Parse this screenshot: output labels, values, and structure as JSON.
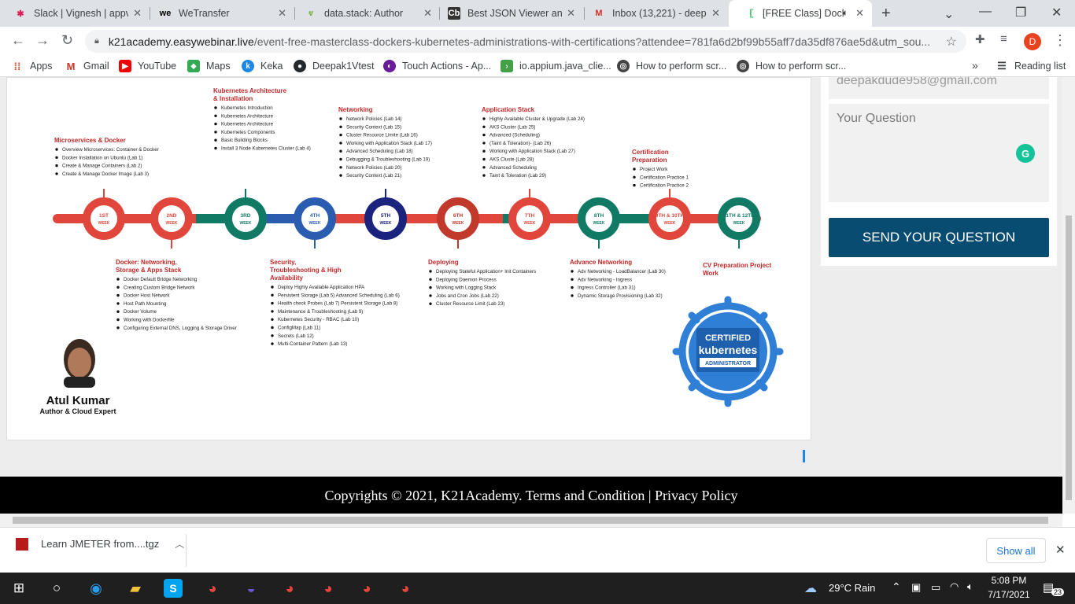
{
  "tabs": [
    {
      "title": "Slack | Vignesh | appve",
      "icon": "slack-icon",
      "color": "#e01e5a"
    },
    {
      "title": "WeTransfer",
      "icon": "wetransfer-icon",
      "color": "#000000"
    },
    {
      "title": "data.stack: Author",
      "icon": "datastack-icon",
      "color": "#7cb342"
    },
    {
      "title": "Best JSON Viewer and",
      "icon": "codebeautify-icon",
      "color": "#333333"
    },
    {
      "title": "Inbox (13,221) - deepa",
      "icon": "gmail-icon",
      "color": "#d93025"
    },
    {
      "title": "[FREE Class] Docke",
      "icon": "easywebinar-icon",
      "color": "#1db954"
    }
  ],
  "address": {
    "host": "k21academy.easywebinar.live",
    "path": "/event-free-masterclass-dockers-kubernetes-administrations-with-certifications?attendee=781fa6d2bf99b55aff7da35df876ae5d&utm_sou..."
  },
  "profile_initial": "D",
  "bookmarks": [
    {
      "label": "Apps"
    },
    {
      "label": "Gmail"
    },
    {
      "label": "YouTube"
    },
    {
      "label": "Maps"
    },
    {
      "label": "Keka"
    },
    {
      "label": "Deepak1Vtest"
    },
    {
      "label": "Touch Actions - Ap..."
    },
    {
      "label": "io.appium.java_clie..."
    },
    {
      "label": "How to perform scr..."
    },
    {
      "label": "How to perform scr..."
    },
    {
      "label": "Reading list"
    }
  ],
  "roadmap": {
    "weeks": [
      "1ST WEEK",
      "2ND WEEK",
      "3RD WEEK",
      "4TH WEEK",
      "5TH WEEK",
      "6TH WEEK",
      "7TH WEEK",
      "8TH WEEK",
      "9TH & 10TH WEEK",
      "11TH & 12TH WEEK"
    ],
    "top_sections": [
      {
        "title": "Microservices & Docker",
        "items": [
          "Overview Microservices: Container & Docker",
          "Docker Installation on Ubuntu (Lab 1)",
          "Create & Manage Containers (Lab 2)",
          "Create & Manage Docker Image (Lab 3)"
        ]
      },
      {
        "title": "Kubernetes Architecture & Installation",
        "items": [
          "Kubernetes Introduction",
          "Kubernetes Architecture",
          "Kubernetes Architecture",
          "Kubernetes Components",
          "Basic Building Blocks",
          "Install 3 Node Kubernetes Cluster (Lab 4)"
        ]
      },
      {
        "title": "Networking",
        "items": [
          "Network Policies (Lab 14)",
          "Security Context (Lab 15)",
          "Cluster Resource Limite (Lab 16)",
          "Working with Application Stack (Lab 17)",
          "Advanced Scheduling (Lab 18)",
          "Debugging & Troubleshooting (Lab 19)",
          "Network Policies (Lab 20)",
          "Security Context (Lab 21)"
        ]
      },
      {
        "title": "Application Stack",
        "items": [
          "Highly Available Cluster & Upgrade (Lab 24)",
          "AKS Cluster (Lab 25)",
          "Advanced (Scheduling)",
          "(Taint & Toleration)- (Lab 26)",
          "Working with Application Stack (Lab 27)",
          "AKS Cluste (Lab 28)",
          "Advanced Scheduling",
          "Taint & Toleration (Lab 29)"
        ]
      },
      {
        "title": "Certification Preparation",
        "items": [
          "Project Work",
          "Certification Practice 1",
          "Certification Practice 2"
        ]
      }
    ],
    "bottom_sections": [
      {
        "title": "Docker: Networking, Storage & Apps Stack",
        "items": [
          "Docker Default Bridge Networking",
          "Creating Custom Bridge Network",
          "Docker Host Network",
          "Host Path Mounting",
          "Docker Volume",
          "Working with Dockerfile",
          "Configuring External DNS, Logging & Storage Driver"
        ]
      },
      {
        "title": "Security, Troubleshooting & High Availability",
        "items": [
          "Deploy Highly Available Application HPA",
          "Persistent Storage (Lab 5) Advanced Scheduling (Lab 6)",
          "Health check Probes (Lab 7) Persistent Storage (Lab 8)",
          "Maintenance & Troubleshooting (Lab 9)",
          "Kubernetes Security - RBAC (Lab 10)",
          "ConfigMap (Lab 11)",
          "Secrets (Lab 12)",
          "Multi-Container Pattern (Lab 13)"
        ]
      },
      {
        "title": "Deploying",
        "items": [
          "Deploying Stateful Application+ Init Containers",
          "Deploying Daemon Process",
          "Working with Logging Stack",
          "Jobs and Cron Jobs (Lab 22)",
          "Cluster Resource Limit (Lab 23)"
        ]
      },
      {
        "title": "Advance Networking",
        "items": [
          "Adv Networking - LoadBalancer (Lab 30)",
          "Adv Networking - Ingress",
          "Ingress Controller (Lab 31)",
          "Dynamic Storage Provisioning (Lab 32)"
        ]
      },
      {
        "title": "CV Preparation Project Work",
        "items": []
      }
    ],
    "author_name": "Atul Kumar",
    "author_role": "Author & Cloud Expert",
    "badge": {
      "line1": "CERTIFIED",
      "line2": "kubernetes",
      "line3": "ADMINISTRATOR"
    }
  },
  "form": {
    "email": "deepakdude958@gmail.com",
    "question_placeholder": "Your Question",
    "send_label": "SEND YOUR QUESTION"
  },
  "footer": {
    "text": "Copyrights © 2021, K21Academy. Terms and Condition | Privacy Policy"
  },
  "download": {
    "filename": "Learn JMETER from....tgz",
    "show_all": "Show all"
  },
  "taskbar": {
    "weather": "29°C  Rain",
    "time": "5:08 PM",
    "date": "7/17/2021",
    "notifications": "23"
  }
}
